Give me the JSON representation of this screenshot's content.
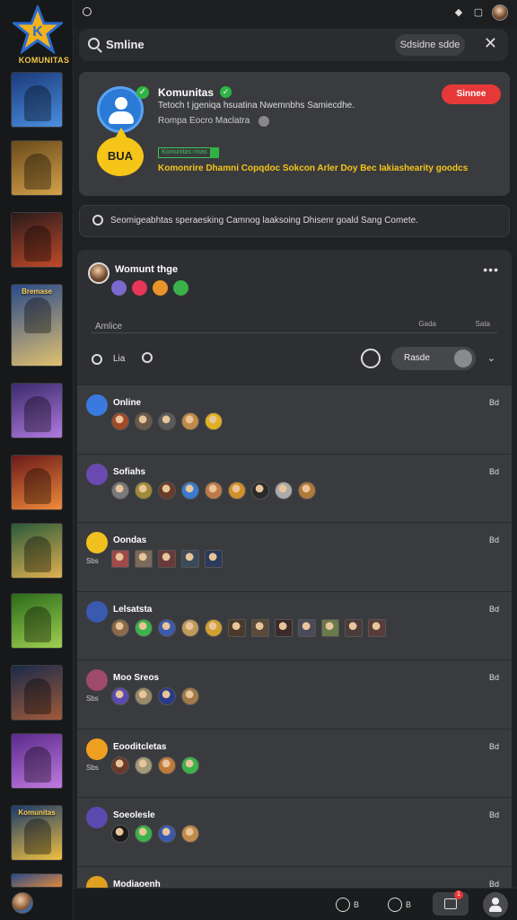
{
  "app": {
    "logo_text": "KOMUNITAS"
  },
  "rail": {
    "tiles": [
      {
        "caption": "",
        "colors": [
          "#1b3a7a",
          "#4a8fe0"
        ]
      },
      {
        "caption": "",
        "colors": [
          "#6a4a1a",
          "#d4a24a"
        ]
      },
      {
        "caption": "",
        "colors": [
          "#2a1a1a",
          "#c04a2a"
        ]
      },
      {
        "caption": "Bremase",
        "colors": [
          "#2a4a8a",
          "#e0c070"
        ]
      },
      {
        "caption": "",
        "colors": [
          "#3a2a6a",
          "#b07ae0"
        ]
      },
      {
        "caption": "",
        "colors": [
          "#6a1a1a",
          "#f08a3a"
        ]
      },
      {
        "caption": "",
        "colors": [
          "#2a5a3a",
          "#e0b050"
        ]
      },
      {
        "caption": "",
        "colors": [
          "#2a6a1a",
          "#a0d050"
        ]
      },
      {
        "caption": "",
        "colors": [
          "#1a2a4a",
          "#a05a3a"
        ]
      },
      {
        "caption": "",
        "colors": [
          "#5a2a8a",
          "#c07ae0"
        ]
      },
      {
        "caption": "Komunitas",
        "colors": [
          "#1a3a6a",
          "#f0c040"
        ]
      },
      {
        "caption": "",
        "colors": [
          "#2a4a8a",
          "#e08a3a"
        ]
      }
    ]
  },
  "search": {
    "query": "Smline",
    "pill_label": "Sdsidne sdde"
  },
  "profile": {
    "name": "Komunitas",
    "bubble_text": "BUA",
    "description": "Tetoch t jgeniqa hsuatina Nwemnbhs Samiecdhe.",
    "subline": "Rompa Eocro Maclatra",
    "tag": "Komunitas rmas",
    "promo": "Komonrire Dhamni Copqdoc Sokcon Arler Doy Bec Iakiashearity goodcs",
    "join_label": "Sinnee"
  },
  "search2": {
    "placeholder": "Seomigeabhtas speraesking Camnog laaksoing Dhisenr goald Sang Comete."
  },
  "community": {
    "title": "Womunt thge",
    "tab_label": "Amlice",
    "tab_right_1": "Gada",
    "tab_right_2": "Sata",
    "tool_label": "Lia",
    "pill_label": "Rasde",
    "reactions": [
      "#7a6ad0",
      "#e8355a",
      "#e8942a",
      "#3bb24a"
    ],
    "groups": [
      {
        "name": "Online",
        "count": "Bd",
        "icon_color": "#3a7ae0",
        "sub": "",
        "avatars": [
          "#a04a2a",
          "#6a5a4a",
          "#5a5a5a",
          "#c08a4a",
          "#e0b020"
        ]
      },
      {
        "name": "Sofiahs",
        "count": "Bd",
        "icon_color": "#6a4ab0",
        "sub": "",
        "avatars": [
          "#7a7a7a",
          "#a08a3a",
          "#6a3a2a",
          "#3a7ad0",
          "#c07a4a",
          "#d0902a",
          "#2a2a2a",
          "#aaaaaa",
          "#b07a3a"
        ]
      },
      {
        "name": "Oondas",
        "count": "Bd",
        "icon_color": "#f0c020",
        "sub": "Sbs",
        "avatars": [
          "#a04a4a",
          "#7a6a5a",
          "#6a3a3a",
          "#3a4a5a",
          "#2a3a5a"
        ]
      },
      {
        "name": "Lelsatsta",
        "count": "Bd",
        "icon_color": "#3a5ab0",
        "sub": "",
        "avatars": [
          "#8a6a4a",
          "#3bb24a",
          "#3a5ab0",
          "#c09a5a",
          "#d0a030",
          "#4a3a2a",
          "#5a4a3a",
          "#3a2a2a",
          "#4a4a5a",
          "#6a7a4a",
          "#4a3a3a",
          "#5a3a3a"
        ]
      },
      {
        "name": "Moo Sreos",
        "count": "Bd",
        "icon_color": "#a04a6a",
        "sub": "Sbs",
        "avatars": [
          "#5a4ab0",
          "#9a8a6a",
          "#2a3a8a",
          "#a07a4a"
        ]
      },
      {
        "name": "Eooditcletas",
        "count": "Bd",
        "icon_color": "#f0a020",
        "sub": "Sbs",
        "avatars": [
          "#6a3a2a",
          "#a09a7a",
          "#c07a3a",
          "#3bb24a"
        ]
      },
      {
        "name": "Soeolesle",
        "count": "Bd",
        "icon_color": "#5a4ab0",
        "sub": "",
        "avatars": [
          "#1a1a1a",
          "#3bb24a",
          "#3a5ab0",
          "#c08a4a"
        ]
      },
      {
        "name": "Modiaoenh",
        "count": "Bd",
        "icon_color": "#e0a020",
        "sub": "",
        "avatars": []
      }
    ]
  },
  "bottombar": {
    "btn1_label": "B",
    "btn2_label": "B",
    "badge": "1"
  }
}
